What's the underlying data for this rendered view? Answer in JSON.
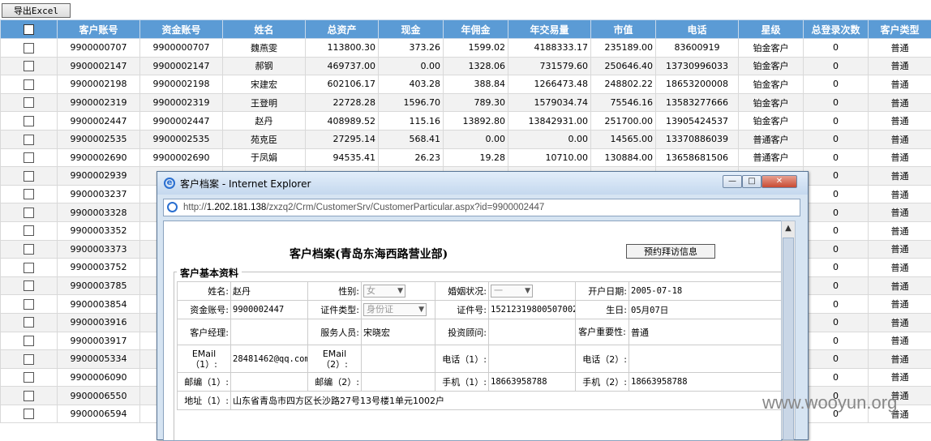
{
  "toolbar": {
    "export_label": "导出Excel"
  },
  "table": {
    "headers": [
      "",
      "客户账号",
      "资金账号",
      "姓名",
      "总资产",
      "现金",
      "年佣金",
      "年交易量",
      "市值",
      "电话",
      "星级",
      "总登录次数",
      "客户类型"
    ],
    "rows": [
      [
        "9900000707",
        "9900000707",
        "魏燕雯",
        "113800.30",
        "373.26",
        "1599.02",
        "4188333.17",
        "235189.00",
        "83600919",
        "铂金客户",
        "0",
        "普通"
      ],
      [
        "9900002147",
        "9900002147",
        "郝钢",
        "469737.00",
        "0.00",
        "1328.06",
        "731579.60",
        "250646.40",
        "13730996033",
        "铂金客户",
        "0",
        "普通"
      ],
      [
        "9900002198",
        "9900002198",
        "宋建宏",
        "602106.17",
        "403.28",
        "388.84",
        "1266473.48",
        "248802.22",
        "18653200008",
        "铂金客户",
        "0",
        "普通"
      ],
      [
        "9900002319",
        "9900002319",
        "王登明",
        "22728.28",
        "1596.70",
        "789.30",
        "1579034.74",
        "75546.16",
        "13583277666",
        "铂金客户",
        "0",
        "普通"
      ],
      [
        "9900002447",
        "9900002447",
        "赵丹",
        "408989.52",
        "115.16",
        "13892.80",
        "13842931.00",
        "251700.00",
        "13905424537",
        "铂金客户",
        "0",
        "普通"
      ],
      [
        "9900002535",
        "9900002535",
        "苑克臣",
        "27295.14",
        "568.41",
        "0.00",
        "0.00",
        "14565.00",
        "13370886039",
        "普通客户",
        "0",
        "普通"
      ],
      [
        "9900002690",
        "9900002690",
        "于凤娟",
        "94535.41",
        "26.23",
        "19.28",
        "10710.00",
        "130884.00",
        "13658681506",
        "普通客户",
        "0",
        "普通"
      ],
      [
        "9900002939",
        "",
        "",
        "",
        "",
        "",
        "",
        "",
        "",
        "",
        "0",
        "普通"
      ],
      [
        "9900003237",
        "",
        "",
        "",
        "",
        "",
        "",
        "",
        "",
        "",
        "0",
        "普通"
      ],
      [
        "9900003328",
        "",
        "",
        "",
        "",
        "",
        "",
        "",
        "",
        "",
        "0",
        "普通"
      ],
      [
        "9900003352",
        "",
        "",
        "",
        "",
        "",
        "",
        "",
        "",
        "",
        "0",
        "普通"
      ],
      [
        "9900003373",
        "",
        "",
        "",
        "",
        "",
        "",
        "",
        "",
        "",
        "0",
        "普通"
      ],
      [
        "9900003752",
        "",
        "",
        "",
        "",
        "",
        "",
        "",
        "",
        "",
        "0",
        "普通"
      ],
      [
        "9900003785",
        "",
        "",
        "",
        "",
        "",
        "",
        "",
        "",
        "",
        "0",
        "普通"
      ],
      [
        "9900003854",
        "",
        "",
        "",
        "",
        "",
        "",
        "",
        "",
        "",
        "0",
        "普通"
      ],
      [
        "9900003916",
        "",
        "",
        "",
        "",
        "",
        "",
        "",
        "",
        "",
        "0",
        "普通"
      ],
      [
        "9900003917",
        "",
        "",
        "",
        "",
        "",
        "",
        "",
        "",
        "",
        "0",
        "普通"
      ],
      [
        "9900005334",
        "",
        "",
        "",
        "",
        "",
        "",
        "",
        "",
        "",
        "0",
        "普通"
      ],
      [
        "9900006090",
        "",
        "",
        "",
        "",
        "",
        "",
        "",
        "",
        "",
        "0",
        "普通"
      ],
      [
        "9900006550",
        "",
        "",
        "",
        "",
        "",
        "",
        "",
        "",
        "",
        "0",
        "普通"
      ],
      [
        "9900006594",
        "",
        "",
        "",
        "",
        "",
        "",
        "",
        "",
        "",
        "0",
        "普通"
      ]
    ]
  },
  "popup": {
    "title": "客户档案 - Internet Explorer",
    "url_prefix": "http://",
    "url_host": "1.202.181.138",
    "url_path": "/zxzq2/Crm/CustomerSrv/CustomerParticular.aspx?id=9900002447",
    "doc_title": "客户档案(青岛东海西路营业部)",
    "visit_button": "预约拜访信息",
    "section_title": "客户基本资料",
    "form": {
      "name_label": "姓名:",
      "name_value": "赵丹",
      "gender_label": "性别:",
      "gender_value": "女",
      "marital_label": "婚姻状况:",
      "marital_value": "一",
      "open_date_label": "开户日期:",
      "open_date_value": "2005-07-18",
      "fund_acct_label": "资金账号:",
      "fund_acct_value": "9900002447",
      "id_type_label": "证件类型:",
      "id_type_value": "身份证",
      "id_no_label": "证件号:",
      "id_no_value": "152123198005070026",
      "birthday_label": "生日:",
      "birthday_value": "05月07日",
      "manager_label": "客户经理:",
      "manager_value": "",
      "service_label": "服务人员:",
      "service_value": "宋晓宏",
      "advisor_label": "投资顾问:",
      "advisor_value": "",
      "importance_label": "客户重要性:",
      "importance_value": "普通",
      "email1_label": "EMail（1）:",
      "email1_value": "28481462@qq.com",
      "email2_label": "EMail（2）:",
      "email2_value": "",
      "phone1_label": "电话（1）:",
      "phone1_value": "",
      "phone2_label": "电话（2）:",
      "phone2_value": "",
      "zip1_label": "邮编（1）:",
      "zip1_value": "",
      "zip2_label": "邮编（2）:",
      "zip2_value": "",
      "mobile1_label": "手机（1）:",
      "mobile1_value": "18663958788",
      "mobile2_label": "手机（2）:",
      "mobile2_value": "18663958788",
      "addr1_label": "地址（1）:",
      "addr1_value": "山东省青岛市四方区长沙路27号13号楼1单元1002户"
    }
  },
  "watermark": "www.wooyun.org",
  "colors": {
    "header_bg": "#5b9bd5",
    "row_alt": "#f2f2f2"
  }
}
